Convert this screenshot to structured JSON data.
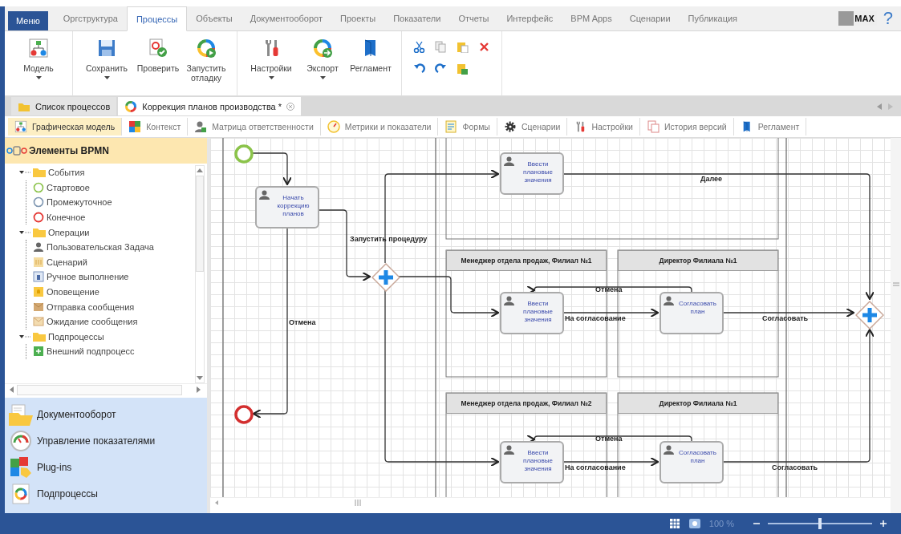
{
  "menu_tabs": [
    {
      "label": "Меню",
      "kind": "app-menu",
      "selected": false
    },
    {
      "label": "Оргструктура",
      "kind": "tab",
      "selected": false
    },
    {
      "label": "Процессы",
      "kind": "tab",
      "selected": true
    },
    {
      "label": "Объекты",
      "kind": "tab",
      "selected": false
    },
    {
      "label": "Документооборот",
      "kind": "tab",
      "selected": false
    },
    {
      "label": "Проекты",
      "kind": "tab",
      "selected": false
    },
    {
      "label": "Показатели",
      "kind": "tab",
      "selected": false
    },
    {
      "label": "Отчеты",
      "kind": "tab",
      "selected": false
    },
    {
      "label": "Интерфейс",
      "kind": "tab",
      "selected": false
    },
    {
      "label": "BPM Apps",
      "kind": "tab",
      "selected": false
    },
    {
      "label": "Сценарии",
      "kind": "tab",
      "selected": false
    },
    {
      "label": "Публикация",
      "kind": "tab",
      "selected": false
    }
  ],
  "user_badge": "MAX",
  "help": "?",
  "ribbon": [
    {
      "buttons": [
        {
          "label": "Модель",
          "dropdown": true
        }
      ]
    },
    {
      "buttons": [
        {
          "label": "Сохранить",
          "dropdown": true
        },
        {
          "label": "Проверить",
          "dropdown": false
        },
        {
          "label": "Запустить отладку",
          "dropdown": false
        }
      ]
    },
    {
      "buttons": [
        {
          "label": "Настройки",
          "dropdown": true
        },
        {
          "label": "Экспорт",
          "dropdown": true
        },
        {
          "label": "Регламент",
          "dropdown": false
        }
      ]
    }
  ],
  "doc_tabs": [
    {
      "label": "Список процессов",
      "selected": false,
      "closable": false
    },
    {
      "label": "Коррекция планов производства *",
      "selected": true,
      "closable": true
    }
  ],
  "view_tabs": [
    {
      "label": "Графическая модель",
      "selected": true
    },
    {
      "label": "Контекст",
      "selected": false
    },
    {
      "label": "Матрица ответственности",
      "selected": false
    },
    {
      "label": "Метрики и показатели",
      "selected": false
    },
    {
      "label": "Формы",
      "selected": false
    },
    {
      "label": "Сценарии",
      "selected": false
    },
    {
      "label": "Настройки",
      "selected": false
    },
    {
      "label": "История версий",
      "selected": false
    },
    {
      "label": "Регламент",
      "selected": false
    }
  ],
  "palette": {
    "title": "Элементы BPMN",
    "tree": [
      {
        "label": "События",
        "expanded": true,
        "children": [
          {
            "label": "Стартовое",
            "kind": "start"
          },
          {
            "label": "Промежуточное",
            "kind": "intermediate"
          },
          {
            "label": "Конечное",
            "kind": "end"
          }
        ]
      },
      {
        "label": "Операции",
        "expanded": true,
        "children": [
          {
            "label": "Пользовательская Задача",
            "kind": "user"
          },
          {
            "label": "Сценарий",
            "kind": "script"
          },
          {
            "label": "Ручное выполнение",
            "kind": "manual"
          },
          {
            "label": "Оповещение",
            "kind": "notify"
          },
          {
            "label": "Отправка сообщения",
            "kind": "send"
          },
          {
            "label": "Ожидание сообщения",
            "kind": "receive"
          }
        ]
      },
      {
        "label": "Подпроцессы",
        "expanded": true,
        "children": [
          {
            "label": "Внешний подпроцесс",
            "kind": "subprocess"
          }
        ]
      }
    ]
  },
  "nav": [
    {
      "label": "Документооборот"
    },
    {
      "label": "Управление показателями"
    },
    {
      "label": "Plug-ins"
    },
    {
      "label": "Подпроцессы"
    }
  ],
  "diagram": {
    "lanes": [
      {
        "title": "Менеджер отдела продаж, Филиал №1"
      },
      {
        "title": "Директор Филиала №1"
      },
      {
        "title": "Менеджер отдела продаж, Филиал №2"
      },
      {
        "title": "Директор Филиала №1"
      }
    ],
    "nodes": [
      {
        "kind": "start"
      },
      {
        "kind": "task",
        "label": "Начать коррекцию планов"
      },
      {
        "kind": "end"
      },
      {
        "kind": "gateway"
      },
      {
        "kind": "task",
        "label": "Ввести плановые значения"
      },
      {
        "kind": "task",
        "label": "Ввести плановые значения"
      },
      {
        "kind": "task",
        "label": "Согласовать план"
      },
      {
        "kind": "task",
        "label": "Ввести плановые значения"
      },
      {
        "kind": "task",
        "label": "Согласовать план"
      },
      {
        "kind": "gateway"
      }
    ],
    "flow_labels": [
      "Далее",
      "Запустить процедуру",
      "Отмена",
      "На согласование",
      "Согласовать",
      "Отмена",
      "Отмена",
      "На согласование",
      "Согласовать"
    ]
  },
  "status_bar": {
    "zoom": "100 %",
    "zoom_slider": {
      "level": 0.5
    }
  }
}
